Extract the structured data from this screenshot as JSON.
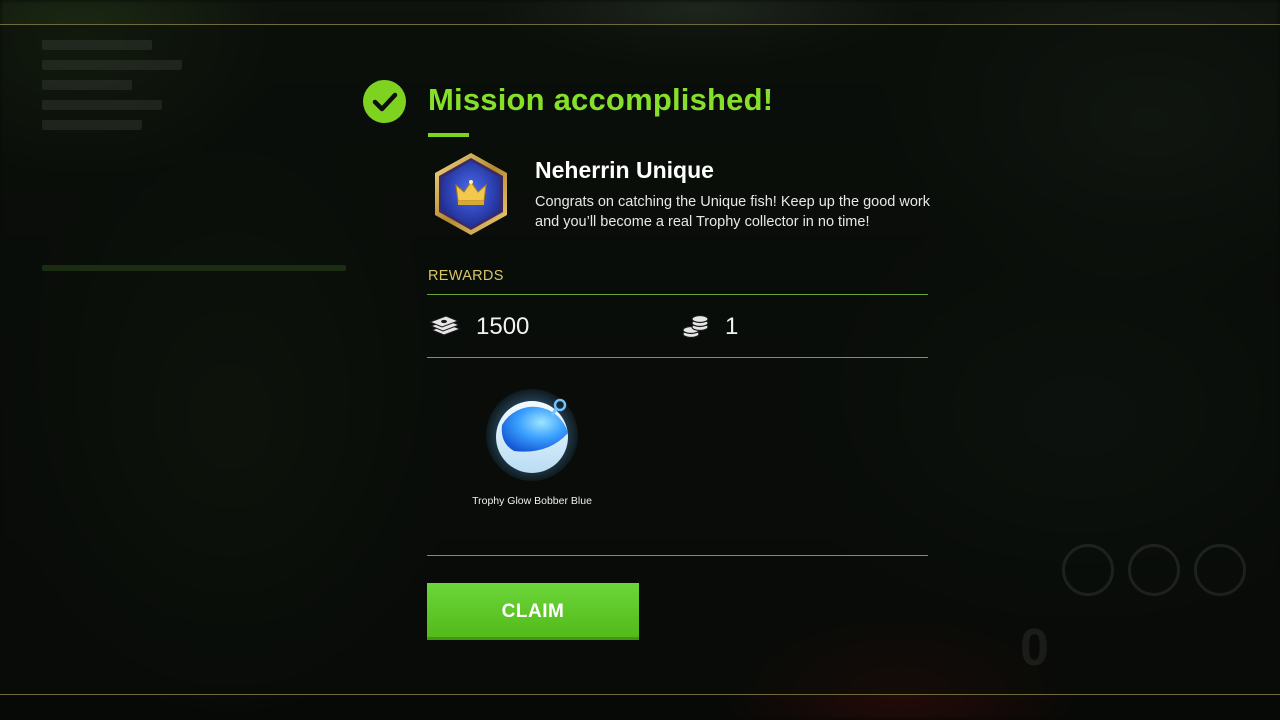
{
  "header": {
    "title": "Mission accomplished!",
    "accent_color": "#7ed321"
  },
  "mission": {
    "name": "Neherrin Unique",
    "description": "Congrats on catching the Unique fish! Keep up the good work and you’ll become a real Trophy collector in no time!",
    "badge_icon": "crown-hexagon-badge"
  },
  "rewards": {
    "label": "REWARDS",
    "currency": [
      {
        "icon": "cash-stack-icon",
        "value": "1500"
      },
      {
        "icon": "coin-stack-icon",
        "value": "1"
      }
    ],
    "items": [
      {
        "icon": "glow-bobber-icon",
        "label": "Trophy Glow Bobber Blue"
      }
    ]
  },
  "actions": {
    "claim_label": "CLAIM",
    "claim_color": "#5cc425"
  }
}
